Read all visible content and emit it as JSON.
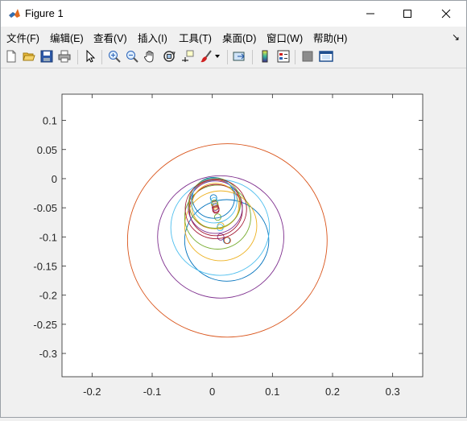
{
  "window": {
    "title": "Figure 1"
  },
  "menu": [
    {
      "label": "文件(F)"
    },
    {
      "label": "编辑(E)"
    },
    {
      "label": "查看(V)"
    },
    {
      "label": "插入(I)"
    },
    {
      "label": "工具(T)"
    },
    {
      "label": "桌面(D)"
    },
    {
      "label": "窗口(W)"
    },
    {
      "label": "帮助(H)"
    }
  ],
  "toolbar": [
    "new-figure-icon",
    "open-file-icon",
    "save-icon",
    "print-icon",
    "edit-plot-arrow-icon",
    "zoom-in-icon",
    "zoom-out-icon",
    "pan-hand-icon",
    "rotate-3d-icon",
    "data-cursor-icon",
    "brush-icon",
    "brush-dropdown-icon",
    "link-plot-icon",
    "insert-colorbar-icon",
    "insert-legend-icon",
    "hide-plot-tools-icon",
    "show-plot-tools-icon"
  ],
  "chart_data": {
    "type": "line",
    "xlim": [
      -0.2,
      0.3
    ],
    "ylim": [
      -0.3,
      0.1
    ],
    "xticks": [
      "-0.2",
      "-0.1",
      "0",
      "0.1",
      "0.2",
      "0.3"
    ],
    "yticks": [
      "0.1",
      "0.05",
      "0",
      "-0.05",
      "-0.1",
      "-0.15",
      "-0.2",
      "-0.25",
      "-0.3"
    ],
    "grid": false,
    "series": [
      {
        "kind": "circle",
        "color": "#0072BD",
        "center": [
          0.024,
          -0.106
        ],
        "radius": 0.07
      },
      {
        "kind": "circle",
        "color": "#D95319",
        "center": [
          0.025,
          -0.106
        ],
        "radius": 0.166
      },
      {
        "kind": "circle",
        "color": "#EDB120",
        "center": [
          0.014,
          -0.081
        ],
        "radius": 0.06
      },
      {
        "kind": "circle",
        "color": "#7E2F8E",
        "center": [
          0.014,
          -0.1
        ],
        "radius": 0.105
      },
      {
        "kind": "circle",
        "color": "#77AC30",
        "center": [
          0.009,
          -0.066
        ],
        "radius": 0.055
      },
      {
        "kind": "circle",
        "color": "#4DBEEE",
        "center": [
          0.013,
          -0.084
        ],
        "radius": 0.082
      },
      {
        "kind": "circle",
        "color": "#A2142F",
        "center": [
          0.006,
          -0.054
        ],
        "radius": 0.044
      },
      {
        "kind": "circle",
        "color": "#0072BD",
        "center": [
          0.002,
          -0.033
        ],
        "radius": 0.035
      },
      {
        "kind": "circle",
        "color": "#D95319",
        "center": [
          0.004,
          -0.044
        ],
        "radius": 0.042
      },
      {
        "kind": "circle",
        "color": "#EDB120",
        "center": [
          0.005,
          -0.047
        ],
        "radius": 0.039
      },
      {
        "kind": "circle",
        "color": "#7E2F8E",
        "center": [
          0.005,
          -0.049
        ],
        "radius": 0.045
      },
      {
        "kind": "circle",
        "color": "#77AC30",
        "center": [
          0.004,
          -0.042
        ],
        "radius": 0.043
      },
      {
        "kind": "circle",
        "color": "#4DBEEE",
        "center": [
          0.003,
          -0.038
        ],
        "radius": 0.038
      },
      {
        "kind": "circle",
        "color": "#A2142F",
        "center": [
          0.006,
          -0.052
        ],
        "radius": 0.051
      }
    ]
  }
}
